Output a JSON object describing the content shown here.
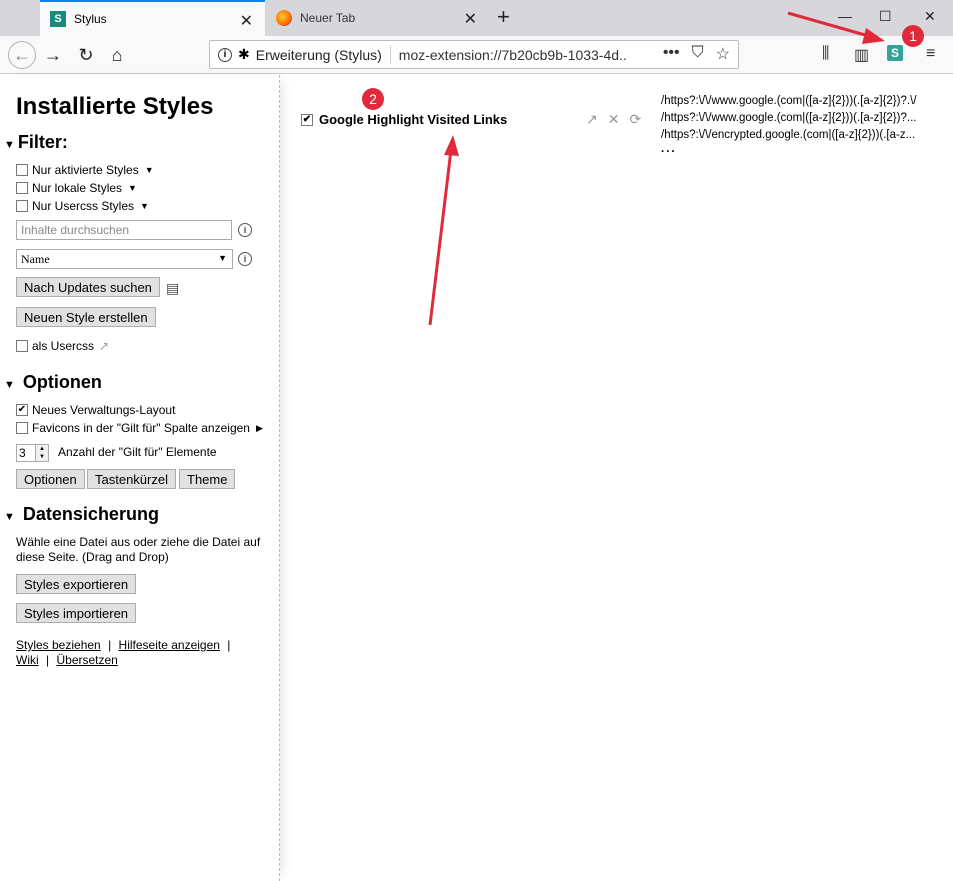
{
  "browser": {
    "tabs": [
      {
        "title": "Stylus",
        "active": true
      },
      {
        "title": "Neuer Tab",
        "active": false
      }
    ],
    "identity_label": "Erweiterung (Stylus)",
    "url": "moz-extension://7b20cb9b-1033-4d..."
  },
  "annotations": {
    "badge1": "1",
    "badge2": "2",
    "color": "#e02a3c"
  },
  "sidebar": {
    "title": "Installierte Styles",
    "filter": {
      "heading": "Filter:",
      "options": [
        "Nur aktivierte Styles",
        "Nur lokale Styles",
        "Nur Usercss Styles"
      ],
      "search_placeholder": "Inhalte durchsuchen",
      "sort_value": "Name",
      "check_updates_label": "Nach Updates suchen",
      "new_style_label": "Neuen Style erstellen",
      "as_usercss_label": "als Usercss"
    },
    "options": {
      "heading": "Optionen",
      "new_layout_label": "Neues Verwaltungs-Layout",
      "new_layout_checked": true,
      "favicons_label": "Favicons in der \"Gilt für\" Spalte anzeigen",
      "applies_count": "3",
      "applies_count_label": "Anzahl der \"Gilt für\" Elemente",
      "buttons": [
        "Optionen",
        "Tastenkürzel",
        "Theme"
      ]
    },
    "backup": {
      "heading": "Datensicherung",
      "description": "Wähle eine Datei aus oder ziehe die Datei auf diese Seite. (Drag and Drop)",
      "export_label": "Styles exportieren",
      "import_label": "Styles importieren"
    },
    "footer_links": [
      "Styles beziehen",
      "Hilfeseite anzeigen",
      "Wiki",
      "Übersetzen"
    ],
    "footer_separator": "|"
  },
  "installed": [
    {
      "name": "Google Highlight Visited Links",
      "enabled": true,
      "applies_to": [
        "/https?:\\/\\/www.google.(com|([a-z]{2}))(.[a-z]{2})?.\\/",
        "/https?:\\/\\/www.google.(com|([a-z]{2}))(.[a-z]{2})?...",
        "/https?:\\/\\/encrypted.google.(com|([a-z]{2}))(.[a-z..."
      ],
      "more": "..."
    }
  ]
}
